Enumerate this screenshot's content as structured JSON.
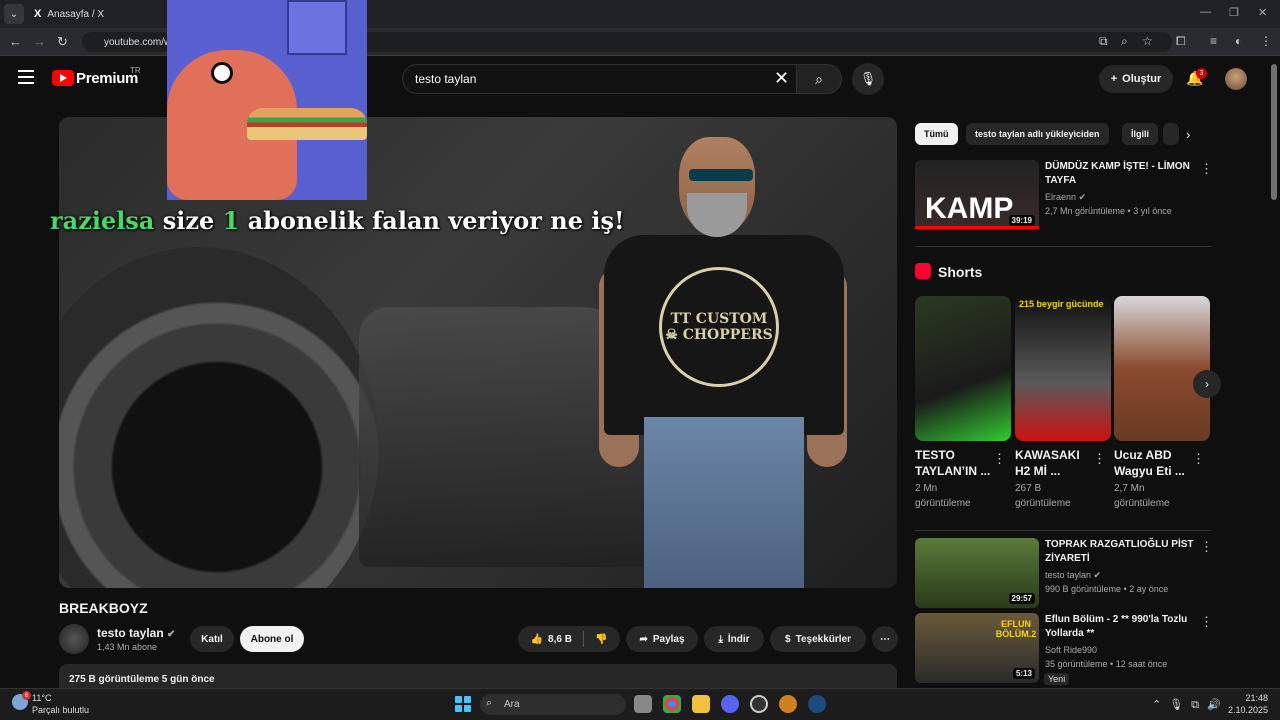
{
  "browser": {
    "tab_title": "Anasayfa / X",
    "tab_icon": "X",
    "url": "youtube.com/watch"
  },
  "header": {
    "brand": "Premium",
    "region": "TR",
    "search_value": "testo taylan",
    "create_label": "Oluştur",
    "notification_count": "3"
  },
  "video": {
    "overlay_user": "razielsa",
    "overlay_text_1": "size",
    "overlay_count": "1",
    "overlay_text_2": "abonelik falan veriyor ne iş!",
    "shirt_logo": "TT CUSTOM ☠ CHOPPERS",
    "title": "BREAKBOYZ",
    "channel": "testo taylan",
    "subscribers": "1,43 Mn abone",
    "join_label": "Katıl",
    "subscribe_label": "Abone ol",
    "likes": "8,6 B",
    "share_label": "Paylaş",
    "download_label": "İndir",
    "thanks_label": "Teşekkürler",
    "description_meta": "275 B görüntüleme  5 gün önce"
  },
  "sidebar": {
    "chips": [
      "Tümü",
      "testo taylan adlı yükleyiciden",
      "İlgili"
    ],
    "related": [
      {
        "title": "DÜMDÜZ KAMP İŞTE!  - LİMON TAYFA",
        "thumb_text": "KAMP",
        "channel": "Elraenn",
        "meta": "2,7 Mn görüntüleme • 3 yıl önce",
        "duration": "39:19"
      },
      {
        "title": "TOPRAK RAZGATLIOĞLU PİST ZİYARETİ",
        "channel": "testo taylan",
        "meta": "990 B görüntüleme • 2 ay önce",
        "duration": "29:57"
      },
      {
        "title": "Eflun Bölüm - 2 ** 990'la Tozlu Yollarda **",
        "thumb_text": "EFLUN BÖLÜM.2",
        "channel": "Soft Ride990",
        "meta": "35 görüntüleme • 12 saat önce",
        "duration": "5:13",
        "badge": "Yeni"
      }
    ],
    "shorts_label": "Shorts",
    "shorts": [
      {
        "title": "TESTO TAYLAN’IN ...",
        "views": "2 Mn",
        "views_suffix": "görüntüleme"
      },
      {
        "title": "KAWASAKI H2 Mİ ...",
        "views": "267 B",
        "views_suffix": "görüntüleme",
        "caption": "215 beygir gücünde"
      },
      {
        "title": "Ucuz ABD Wagyu Eti ...",
        "views": "2,7 Mn",
        "views_suffix": "görüntüleme"
      }
    ]
  },
  "taskbar": {
    "temperature": "11°C",
    "weather": "Parçalı bulutlu",
    "weather_badge": "6",
    "search_placeholder": "Ara",
    "time": "21:48",
    "date": "2.10.2025"
  }
}
